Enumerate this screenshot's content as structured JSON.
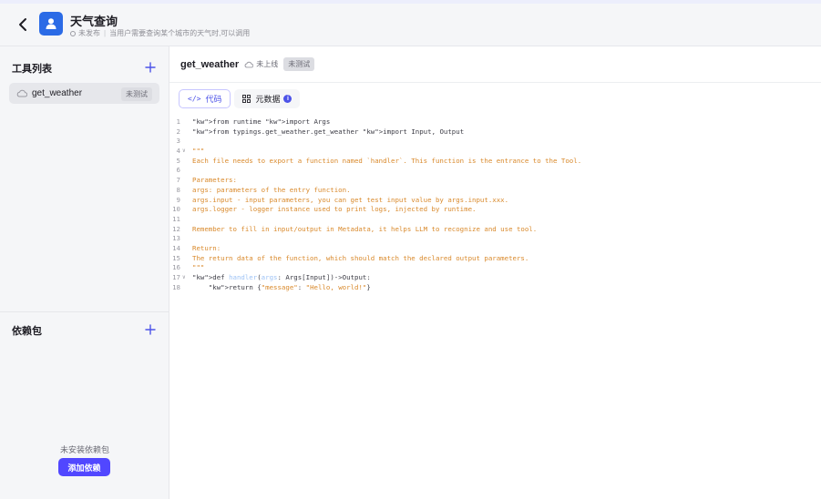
{
  "header": {
    "title": "天气查询",
    "status": "未发布",
    "description": "当用户需要查询某个城市的天气时,可以调用"
  },
  "sidebar": {
    "tools_title": "工具列表",
    "tools": [
      {
        "name": "get_weather",
        "badge": "未测试"
      }
    ],
    "deps_title": "依赖包",
    "deps_empty": "未安装依赖包",
    "add_dep_label": "添加依赖"
  },
  "main": {
    "file_name": "get_weather",
    "online_status": "未上线",
    "test_badge": "未测试",
    "tabs": [
      {
        "label": "代码",
        "icon": "code-icon",
        "active": true
      },
      {
        "label": "元数据",
        "icon": "metadata-icon",
        "active": false,
        "info": "i"
      }
    ]
  },
  "code_lines": [
    {
      "n": "1",
      "text": "from runtime import Args"
    },
    {
      "n": "2",
      "text": "from typings.get_weather.get_weather import Input, Output"
    },
    {
      "n": "3",
      "text": ""
    },
    {
      "n": "4",
      "text": "\"\"\""
    },
    {
      "n": "5",
      "text": "Each file needs to export a function named `handler`. This function is the entrance to the Tool."
    },
    {
      "n": "6",
      "text": ""
    },
    {
      "n": "7",
      "text": "Parameters:"
    },
    {
      "n": "8",
      "text": "args: parameters of the entry function."
    },
    {
      "n": "9",
      "text": "args.input - input parameters, you can get test input value by args.input.xxx."
    },
    {
      "n": "10",
      "text": "args.logger - logger instance used to print logs, injected by runtime."
    },
    {
      "n": "11",
      "text": ""
    },
    {
      "n": "12",
      "text": "Remember to fill in input/output in Metadata, it helps LLM to recognize and use tool."
    },
    {
      "n": "13",
      "text": ""
    },
    {
      "n": "14",
      "text": "Return:"
    },
    {
      "n": "15",
      "text": "The return data of the function, which should match the declared output parameters."
    },
    {
      "n": "16",
      "text": "\"\"\""
    },
    {
      "n": "17",
      "text": "def handler(args: Args[Input])->Output:"
    },
    {
      "n": "18",
      "text": "    return {\"message\": \"Hello, world!\"}"
    }
  ],
  "colors": {
    "accent": "#5147ff",
    "app_icon": "#2b6be6",
    "keyword": "#3f56d1",
    "docstring": "#d9892b"
  }
}
